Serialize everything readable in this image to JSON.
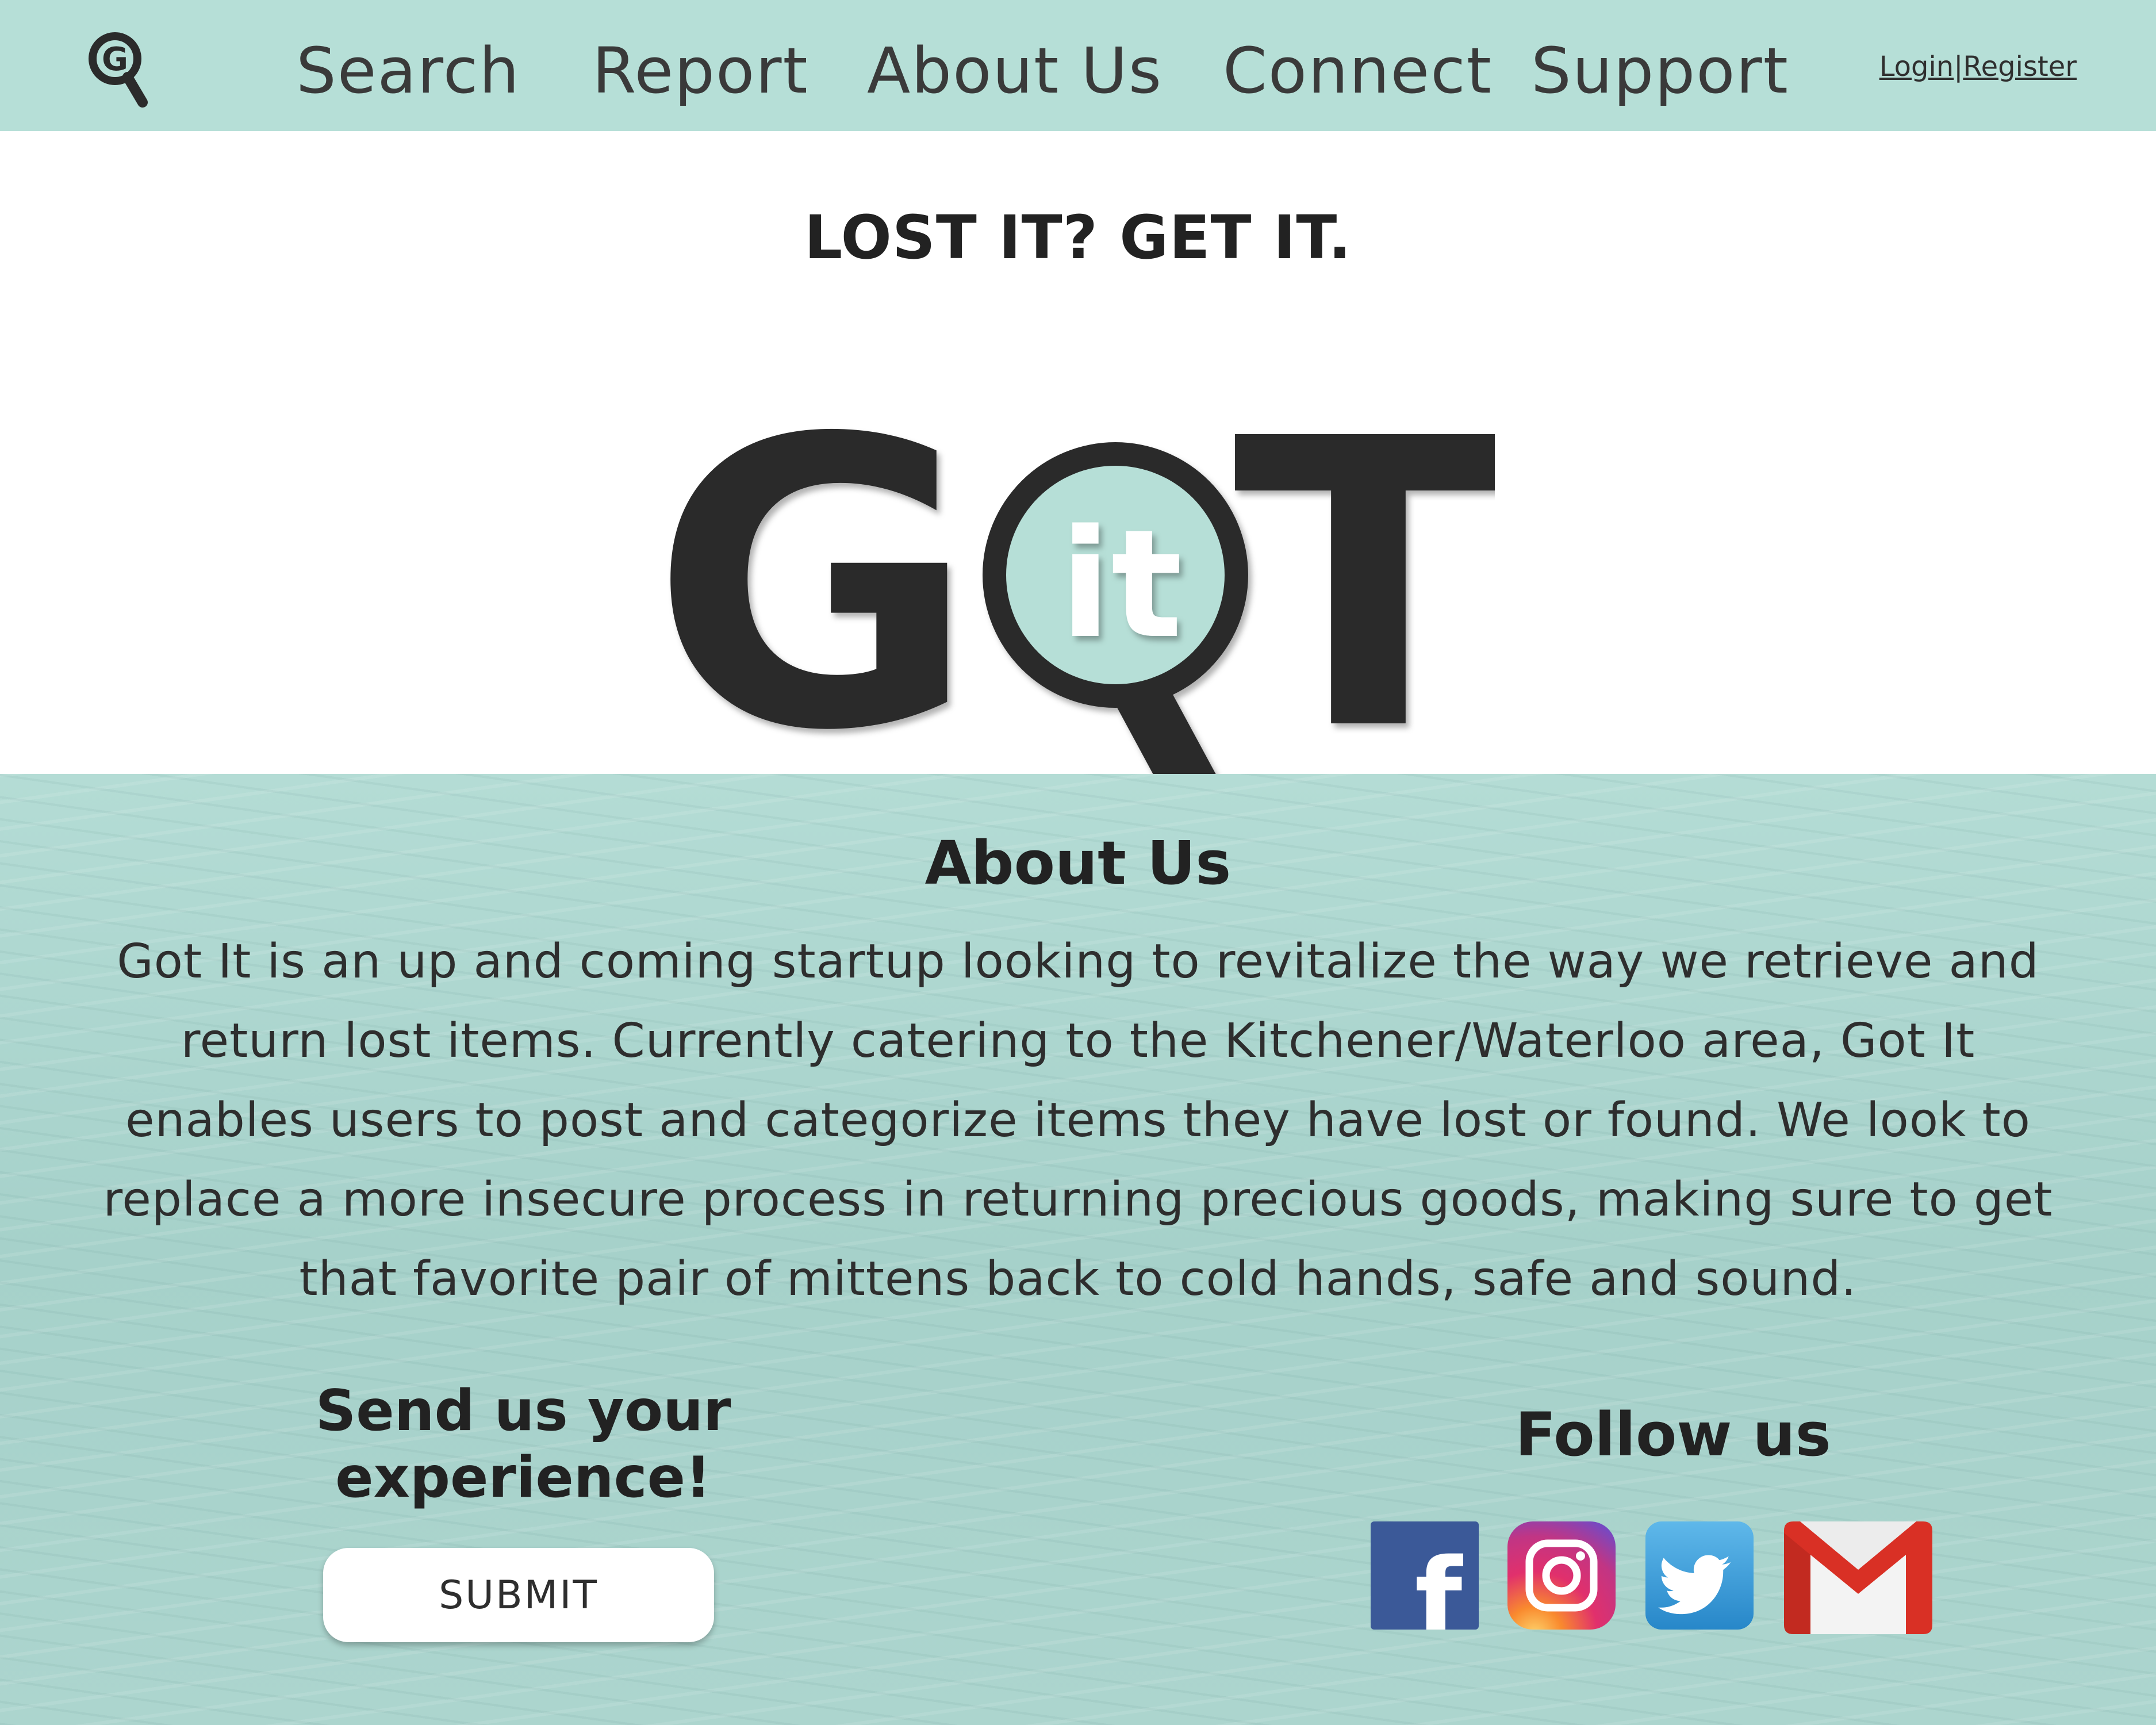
{
  "nav": {
    "logo_letter": "G",
    "links": [
      {
        "label": "Search"
      },
      {
        "label": "Report"
      },
      {
        "label": "About Us"
      },
      {
        "label": "Connect"
      },
      {
        "label": "Support"
      }
    ],
    "login_label": "Login",
    "separator": "|",
    "register_label": "Register"
  },
  "hero": {
    "tagline": "LOST IT? GET IT.",
    "logo_letters": {
      "g": "G",
      "t": "T",
      "lens_text": "it"
    },
    "logo_accent_color": "#b6dfd7",
    "logo_dark_color": "#2b2b2b"
  },
  "about": {
    "title": "About Us",
    "body": "Got It is an up and coming startup looking to revitalize the way we retrieve and return lost items. Currently catering to the Kitchener/Waterloo area, Got It enables users to post and categorize items they have lost or found. We look to replace a more insecure process in returning precious goods, making sure to get that favorite pair of mittens back to cold hands, safe and sound."
  },
  "feedback": {
    "title_line1": "Send us your",
    "title_line2": "experience!",
    "submit_label": "SUBMIT"
  },
  "follow": {
    "title": "Follow us",
    "icons": [
      "facebook-icon",
      "instagram-icon",
      "twitter-icon",
      "gmail-icon"
    ],
    "facebook_letter": "f"
  },
  "colors": {
    "nav_bg": "#b6dfd7",
    "water_bg": "#a9d3cc",
    "text": "#2b2b2b",
    "facebook": "#3b5998",
    "twitter": "#1da1f2",
    "gmail_red": "#d93025"
  }
}
